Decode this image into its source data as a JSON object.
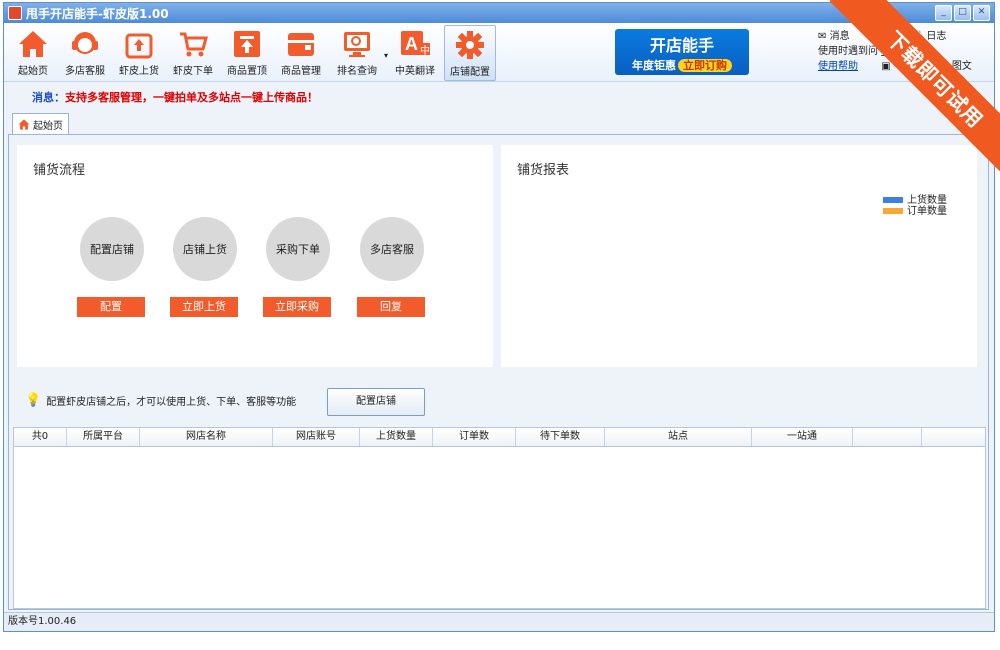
{
  "window": {
    "title": "甩手开店能手-虾皮版1.00"
  },
  "toolbar": {
    "items": [
      {
        "label": "起始页",
        "icon": "home-icon"
      },
      {
        "label": "多店客服",
        "icon": "headset-icon"
      },
      {
        "label": "虾皮上货",
        "icon": "upload-box-icon"
      },
      {
        "label": "虾皮下单",
        "icon": "cart-icon"
      },
      {
        "label": "商品置顶",
        "icon": "top-icon"
      },
      {
        "label": "商品管理",
        "icon": "wallet-icon"
      },
      {
        "label": "排名查询",
        "icon": "monitor-icon"
      },
      {
        "label": "中英翻译",
        "icon": "translate-icon"
      },
      {
        "label": "店铺配置",
        "icon": "gear-icon"
      }
    ]
  },
  "promo": {
    "title": "开店能手",
    "subtitle": "年度钜惠",
    "cta": "立即订购"
  },
  "right_links": {
    "msg": "消息",
    "log": "日志",
    "problem": "使用时遇到问",
    "contact": "联系客服",
    "help": "使用帮助",
    "graphic": "图文"
  },
  "message_bar": {
    "key": "消息：",
    "text": "支持多客服管理，一键拍单及多站点一键上传商品！"
  },
  "tabs": [
    {
      "label": "起始页"
    }
  ],
  "process_panel": {
    "title": "铺货流程",
    "steps": [
      {
        "circle": "配置店铺",
        "button": "配置"
      },
      {
        "circle": "店铺上货",
        "button": "立即上货"
      },
      {
        "circle": "采购下单",
        "button": "立即采购"
      },
      {
        "circle": "多店客服",
        "button": "回复"
      }
    ]
  },
  "report_panel": {
    "title": "铺货报表",
    "legend": [
      {
        "name": "上货数量",
        "color": "#3f7fe4"
      },
      {
        "name": "订单数量",
        "color": "#f6a938"
      }
    ]
  },
  "hint": {
    "text": "配置虾皮店铺之后，才可以使用上货、下单、客服等功能",
    "button": "配置店铺"
  },
  "table": {
    "columns": [
      "共0",
      "所属平台",
      "网店名称",
      "网店账号",
      "上货数量",
      "订单数",
      "待下单数",
      "站点",
      "一站通",
      ""
    ]
  },
  "status": {
    "version": "版本号1.00.46"
  },
  "ribbon": {
    "text": "下载即可试用"
  }
}
